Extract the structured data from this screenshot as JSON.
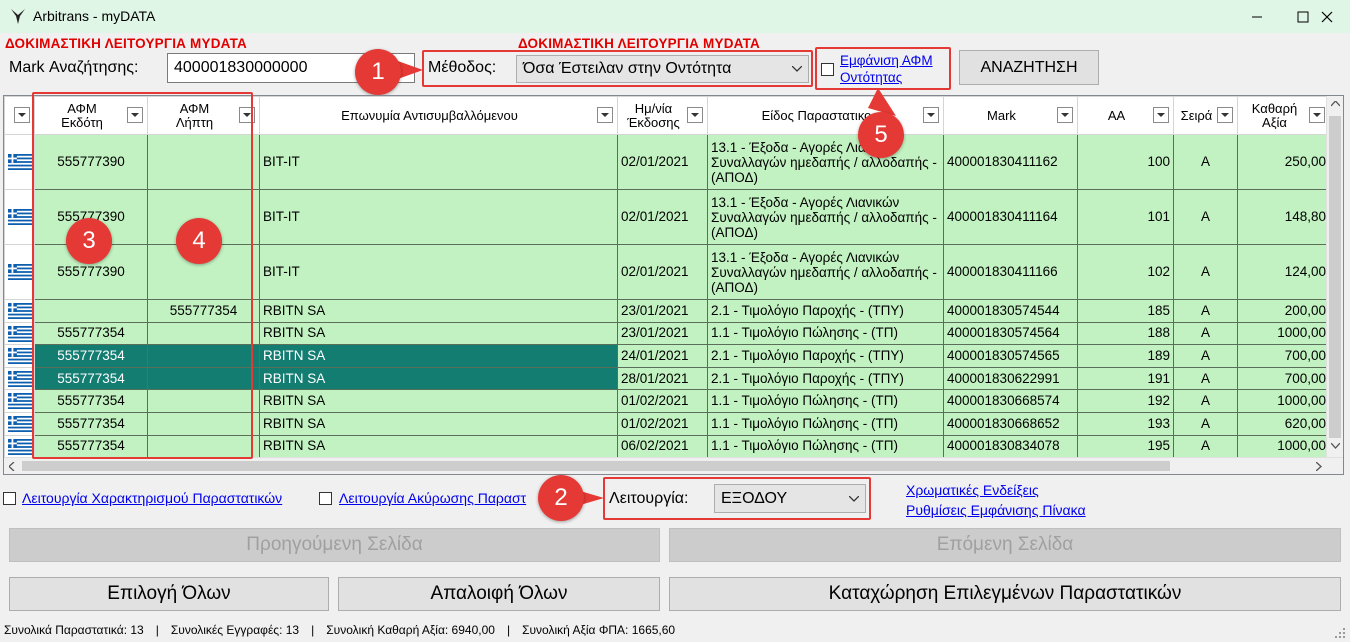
{
  "window": {
    "title": "Arbitrans - myDATA"
  },
  "banner": {
    "left": "ΔΟΚΙΜΑΣΤΙΚΗ ΛΕΙΤΟΥΡΓΙΑ MYDATA",
    "right": "ΔΟΚΙΜΑΣΤΙΚΗ ΛΕΙΤΟΥΡΓΙΑ MYDATA"
  },
  "search": {
    "mark_label": "Mark Αναζήτησης:",
    "mark_value": "400001830000000",
    "method_label": "Μέθοδος:",
    "method_value": "Όσα Έστειλαν στην Οντότητα",
    "show_afm_link_line1": "Εμφάνιση ΑΦΜ",
    "show_afm_link_line2": "Οντότητας",
    "search_button": "ΑΝΑΖΗΤΗΣΗ"
  },
  "annotations": [
    "1",
    "2",
    "3",
    "4",
    "5"
  ],
  "grid": {
    "columns": [
      {
        "line1": "ΑΦΜ",
        "line2": "Εκδότη"
      },
      {
        "line1": "ΑΦΜ",
        "line2": "Λήπτη"
      },
      {
        "line1": "Επωνυμία Αντισυμβαλλόμενου",
        "line2": ""
      },
      {
        "line1": "Ημ/νία",
        "line2": "Έκδοσης"
      },
      {
        "line1": "Είδος Παραστατικο",
        "line2": ""
      },
      {
        "line1": "Mark",
        "line2": ""
      },
      {
        "line1": "ΑΑ",
        "line2": ""
      },
      {
        "line1": "Σειρά",
        "line2": ""
      },
      {
        "line1": "Καθαρή",
        "line2": "Αξία"
      }
    ],
    "rows": [
      {
        "issuer": "555777390",
        "receiver": "",
        "name": "BIT-IT",
        "date": "02/01/2021",
        "type": "13.1 - Έξοδα - Αγορές Λιανικών Συναλλαγών ημεδαπής / αλλοδαπής - (ΑΠΟΔ)",
        "mark": "400001830411162",
        "aa": "100",
        "series": "Α",
        "net": "250,00",
        "selected": false
      },
      {
        "issuer": "555777390",
        "receiver": "",
        "name": "BIT-IT",
        "date": "02/01/2021",
        "type": "13.1 - Έξοδα - Αγορές Λιανικών Συναλλαγών ημεδαπής / αλλοδαπής - (ΑΠΟΔ)",
        "mark": "400001830411164",
        "aa": "101",
        "series": "Α",
        "net": "148,80",
        "selected": false
      },
      {
        "issuer": "555777390",
        "receiver": "",
        "name": "BIT-IT",
        "date": "02/01/2021",
        "type": "13.1 - Έξοδα - Αγορές Λιανικών Συναλλαγών ημεδαπής / αλλοδαπής - (ΑΠΟΔ)",
        "mark": "400001830411166",
        "aa": "102",
        "series": "Α",
        "net": "124,00",
        "selected": false
      },
      {
        "issuer": "",
        "receiver": "555777354",
        "name": "RBITN SA",
        "date": "23/01/2021",
        "type": "2.1 - Τιμολόγιο Παροχής - (ΤΠΥ)",
        "mark": "400001830574544",
        "aa": "185",
        "series": "Α",
        "net": "200,00",
        "selected": false
      },
      {
        "issuer": "555777354",
        "receiver": "",
        "name": "RBITN SA",
        "date": "23/01/2021",
        "type": "1.1 - Τιμολόγιο Πώλησης - (ΤΠ)",
        "mark": "400001830574564",
        "aa": "188",
        "series": "Α",
        "net": "1000,00",
        "selected": false
      },
      {
        "issuer": "555777354",
        "receiver": "",
        "name": "RBITN SA",
        "date": "24/01/2021",
        "type": "2.1 - Τιμολόγιο Παροχής - (ΤΠΥ)",
        "mark": "400001830574565",
        "aa": "189",
        "series": "Α",
        "net": "700,00",
        "selected": true
      },
      {
        "issuer": "555777354",
        "receiver": "",
        "name": "RBITN SA",
        "date": "28/01/2021",
        "type": "2.1 - Τιμολόγιο Παροχής - (ΤΠΥ)",
        "mark": "400001830622991",
        "aa": "191",
        "series": "Α",
        "net": "700,00",
        "selected": true
      },
      {
        "issuer": "555777354",
        "receiver": "",
        "name": "RBITN SA",
        "date": "01/02/2021",
        "type": "1.1 - Τιμολόγιο Πώλησης - (ΤΠ)",
        "mark": "400001830668574",
        "aa": "192",
        "series": "Α",
        "net": "1000,00",
        "selected": false
      },
      {
        "issuer": "555777354",
        "receiver": "",
        "name": "RBITN SA",
        "date": "01/02/2021",
        "type": "1.1 - Τιμολόγιο Πώλησης - (ΤΠ)",
        "mark": "400001830668652",
        "aa": "193",
        "series": "Α",
        "net": "620,00",
        "selected": false
      },
      {
        "issuer": "555777354",
        "receiver": "",
        "name": "RBITN SA",
        "date": "06/02/2021",
        "type": "1.1 - Τιμολόγιο Πώλησης - (ΤΠ)",
        "mark": "400001830834078",
        "aa": "195",
        "series": "Α",
        "net": "1000,00",
        "selected": false
      }
    ]
  },
  "options": {
    "characterization_link": "Λειτουργία Χαρακτηρισμού Παραστατικών",
    "cancellation_link": "Λειτουργία Ακύρωσης Παραστ",
    "operation_label": "Λειτουργία:",
    "operation_value": "ΕΞΟΔΟΥ",
    "color_legend_link": "Χρωματικές Ενδείξεις",
    "table_settings_link": "Ρυθμίσεις Εμφάνισης Πίνακα"
  },
  "buttons": {
    "prev_page": "Προηγούμενη Σελίδα",
    "next_page": "Επόμενη Σελίδα",
    "select_all": "Επιλογή Όλων",
    "clear_all": "Απαλοιφή Όλων",
    "submit_selected": "Καταχώρηση Επιλεγμένων Παραστατικών"
  },
  "status": {
    "total_docs": "Συνολικά Παραστατικά:  13",
    "total_records": "Συνολικές Εγγραφές:  13",
    "total_net": "Συνολική Καθαρή Αξία:  6940,00",
    "total_vat": "Συνολική Αξία ΦΠΑ:  1665,60",
    "sep": "|"
  },
  "colors": {
    "row_bg": "#c2f2c1",
    "selected_bg": "#147d72",
    "annotation_red": "#e53935",
    "banner_red": "#e00000",
    "titlebar_bg": "#dff5e6"
  }
}
